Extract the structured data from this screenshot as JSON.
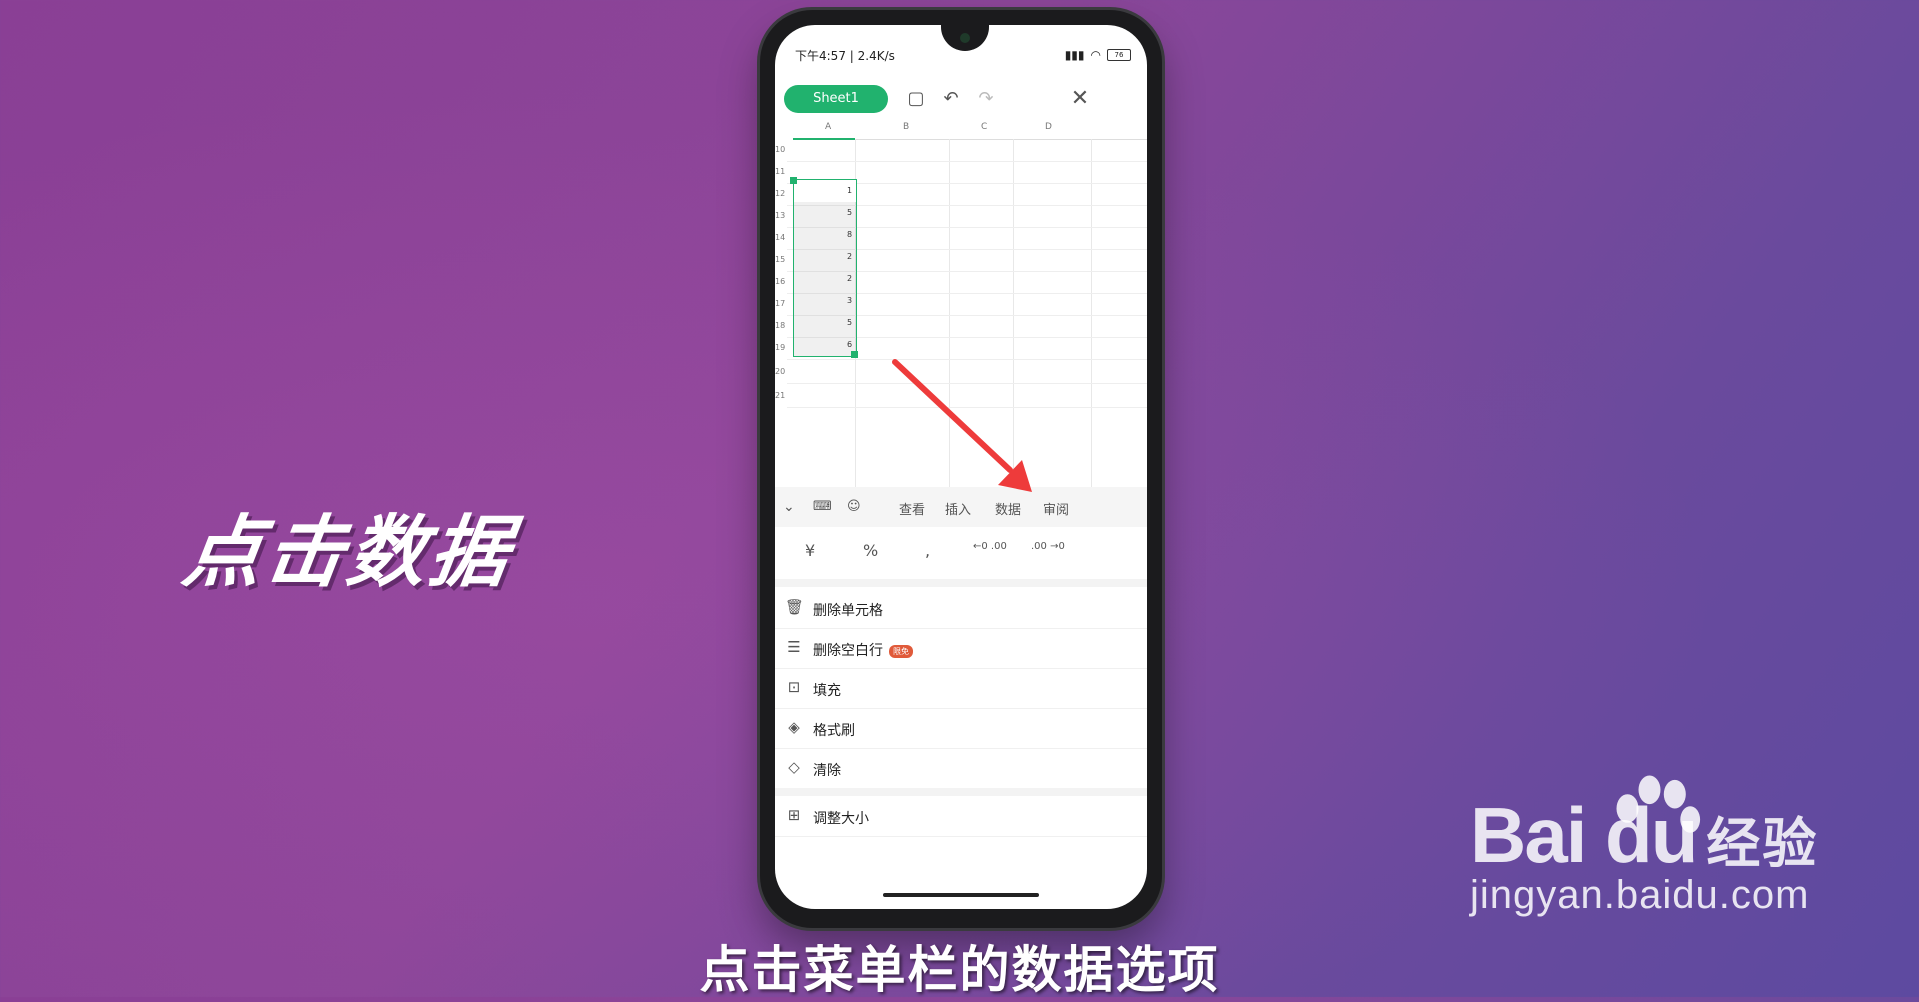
{
  "overlay": {
    "big_title": "点击数据",
    "subtitle": "点击菜单栏的数据选项",
    "watermark_logo": "Bai du",
    "watermark_cn": "经验",
    "watermark_url": "jingyan.baidu.com"
  },
  "status_bar": {
    "time_speed": "下午4:57 | 2.4K/s",
    "battery": "76"
  },
  "toolbar": {
    "sheet_tab": "Sheet1",
    "icons": [
      "save-icon",
      "undo-icon",
      "redo-icon",
      "close-icon"
    ]
  },
  "grid": {
    "columns": [
      "A",
      "B",
      "C",
      "D"
    ],
    "rows": [
      "10",
      "11",
      "12",
      "13",
      "14",
      "15",
      "16",
      "17",
      "18",
      "19",
      "20",
      "21"
    ],
    "column_a_values": [
      "1",
      "5",
      "8",
      "2",
      "2",
      "3",
      "5",
      "6"
    ]
  },
  "menubar": {
    "tabs": [
      "查看",
      "插入",
      "数据",
      "审阅"
    ]
  },
  "format_row": {
    "symbols": [
      "¥",
      "%",
      ",",
      "←0 .00",
      ".00 →0"
    ]
  },
  "menu_items": [
    {
      "label": "删除单元格",
      "icon": "trash-icon"
    },
    {
      "label": "删除空白行",
      "icon": "delete-row-icon",
      "badge": "限免"
    },
    {
      "label": "填充",
      "icon": "fill-icon"
    },
    {
      "label": "格式刷",
      "icon": "brush-icon"
    },
    {
      "label": "清除",
      "icon": "eraser-icon"
    },
    {
      "label": "调整大小",
      "icon": "resize-icon"
    }
  ],
  "colors": {
    "accent": "#21b26e",
    "arrow": "#ee3b3b",
    "badge": "#e05a3a"
  }
}
